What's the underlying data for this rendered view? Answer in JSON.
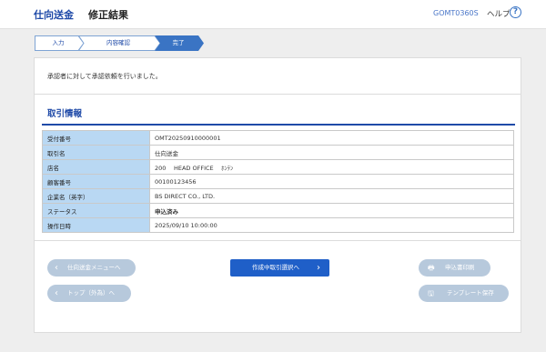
{
  "header": {
    "title": "仕向送金",
    "subtitle": "修正結果",
    "screen_code": "GOMT0360S",
    "help_label": "ヘルプ",
    "help_icon_glyph": "?"
  },
  "steps": [
    {
      "label": "入力",
      "state": "done"
    },
    {
      "label": "内容確認",
      "state": "done"
    },
    {
      "label": "完了",
      "state": "current"
    }
  ],
  "message": "承認者に対して承認依頼を行いました。",
  "section": {
    "title": "取引情報",
    "rows": [
      {
        "key": "受付番号",
        "value": "OMT20250910000001"
      },
      {
        "key": "取引名",
        "value": "仕向送金"
      },
      {
        "key": "店名",
        "value": "200　 HEAD OFFICE　 ﾎﾝﾃﾝ"
      },
      {
        "key": "顧客番号",
        "value": "00100123456"
      },
      {
        "key": "企業名（英字）",
        "value": "BS DIRECT CO., LTD."
      },
      {
        "key": "ステータス",
        "value": "申込済み"
      },
      {
        "key": "操作日時",
        "value": "2025/09/10 10:00:00"
      }
    ]
  },
  "buttons": {
    "menu": "仕向送金メニューへ",
    "top": "トップ（外為）へ",
    "select": "作成中取引選択へ",
    "print": "申込書印刷",
    "template": "テンプレート保存"
  },
  "colors": {
    "accent": "#1f4aa8",
    "primary_button": "#1f5fc8",
    "disabled_button": "#b7c9dc",
    "status_red": "#d00000",
    "table_key_bg": "#b9d8f3"
  }
}
